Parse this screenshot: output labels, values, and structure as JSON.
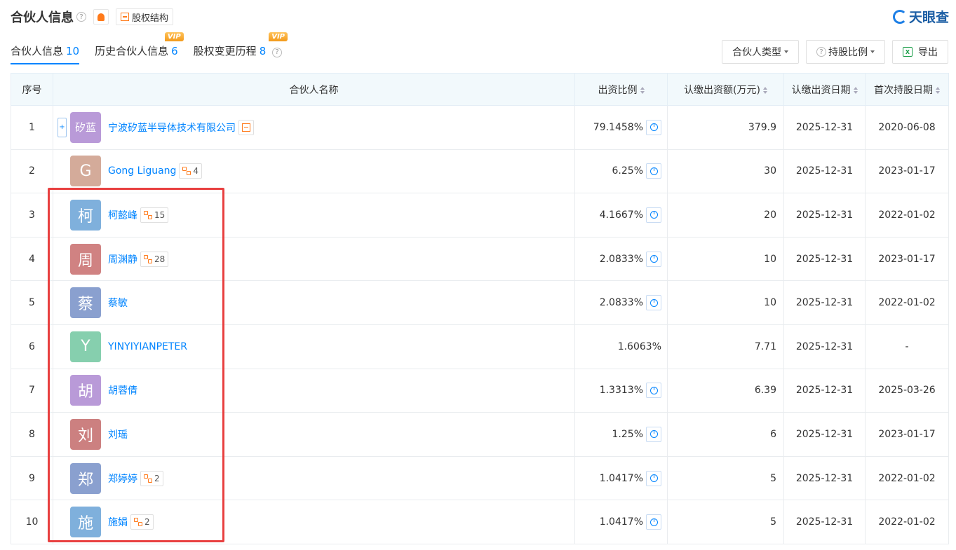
{
  "header": {
    "title": "合伙人信息",
    "help_glyph": "?",
    "equity_structure_label": "股权结构",
    "logo_text": "天眼查"
  },
  "tabs": [
    {
      "label": "合伙人信息",
      "count": "10",
      "vip": ""
    },
    {
      "label": "历史合伙人信息",
      "count": "6",
      "vip": "VIP"
    },
    {
      "label": "股权变更历程",
      "count": "8",
      "vip": "VIP"
    }
  ],
  "controls": {
    "partner_type": "合伙人类型",
    "help_glyph": "?",
    "holding_ratio": "持股比例",
    "excel_glyph": "X",
    "export": "导出"
  },
  "table": {
    "headers": {
      "index": "序号",
      "name": "合伙人名称",
      "ratio": "出资比例",
      "amount": "认缴出资额(万元)",
      "pay_date": "认缴出资日期",
      "first_date": "首次持股日期"
    },
    "rows": [
      {
        "index": "1",
        "avatar_text": "矽蓝",
        "avatar_color": "#b99ad8",
        "name": "宁波矽蓝半导体技术有限公司",
        "badge": "",
        "structure": true,
        "expand": "+",
        "ratio": "79.1458%",
        "pie": true,
        "amount": "379.9",
        "pay_date": "2025-12-31",
        "first_date": "2020-06-08"
      },
      {
        "index": "2",
        "avatar_text": "G",
        "avatar_color": "#d4ab9a",
        "name": "Gong Liguang",
        "badge": "4",
        "structure": false,
        "ratio": "6.25%",
        "pie": true,
        "amount": "30",
        "pay_date": "2025-12-31",
        "first_date": "2023-01-17"
      },
      {
        "index": "3",
        "avatar_text": "柯",
        "avatar_color": "#7fb0dc",
        "name": "柯懿峰",
        "badge": "15",
        "structure": false,
        "ratio": "4.1667%",
        "pie": true,
        "amount": "20",
        "pay_date": "2025-12-31",
        "first_date": "2022-01-02"
      },
      {
        "index": "4",
        "avatar_text": "周",
        "avatar_color": "#d08282",
        "name": "周渊静",
        "badge": "28",
        "structure": false,
        "ratio": "2.0833%",
        "pie": true,
        "amount": "10",
        "pay_date": "2025-12-31",
        "first_date": "2023-01-17"
      },
      {
        "index": "5",
        "avatar_text": "蔡",
        "avatar_color": "#8aa0cf",
        "name": "蔡敏",
        "badge": "",
        "structure": false,
        "ratio": "2.0833%",
        "pie": true,
        "amount": "10",
        "pay_date": "2025-12-31",
        "first_date": "2022-01-02"
      },
      {
        "index": "6",
        "avatar_text": "Y",
        "avatar_color": "#86cfae",
        "name": "YINYIYIANPETER",
        "badge": "",
        "structure": false,
        "ratio": "1.6063%",
        "pie": false,
        "amount": "7.71",
        "pay_date": "2025-12-31",
        "first_date": "-"
      },
      {
        "index": "7",
        "avatar_text": "胡",
        "avatar_color": "#b99ad8",
        "name": "胡蓉倩",
        "badge": "",
        "structure": false,
        "ratio": "1.3313%",
        "pie": true,
        "amount": "6.39",
        "pay_date": "2025-12-31",
        "first_date": "2025-03-26"
      },
      {
        "index": "8",
        "avatar_text": "刘",
        "avatar_color": "#cc8080",
        "name": "刘瑶",
        "badge": "",
        "structure": false,
        "ratio": "1.25%",
        "pie": true,
        "amount": "6",
        "pay_date": "2025-12-31",
        "first_date": "2023-01-17"
      },
      {
        "index": "9",
        "avatar_text": "郑",
        "avatar_color": "#8aa0cf",
        "name": "郑婷婷",
        "badge": "2",
        "structure": false,
        "ratio": "1.0417%",
        "pie": true,
        "amount": "5",
        "pay_date": "2025-12-31",
        "first_date": "2022-01-02"
      },
      {
        "index": "10",
        "avatar_text": "施",
        "avatar_color": "#7fb0dc",
        "name": "施娟",
        "badge": "2",
        "structure": false,
        "ratio": "1.0417%",
        "pie": true,
        "amount": "5",
        "pay_date": "2025-12-31",
        "first_date": "2022-01-02"
      }
    ]
  },
  "colors": {
    "accent": "#0084ff",
    "highlight_box": "#e84040",
    "vip_badge": "#f5a623"
  }
}
